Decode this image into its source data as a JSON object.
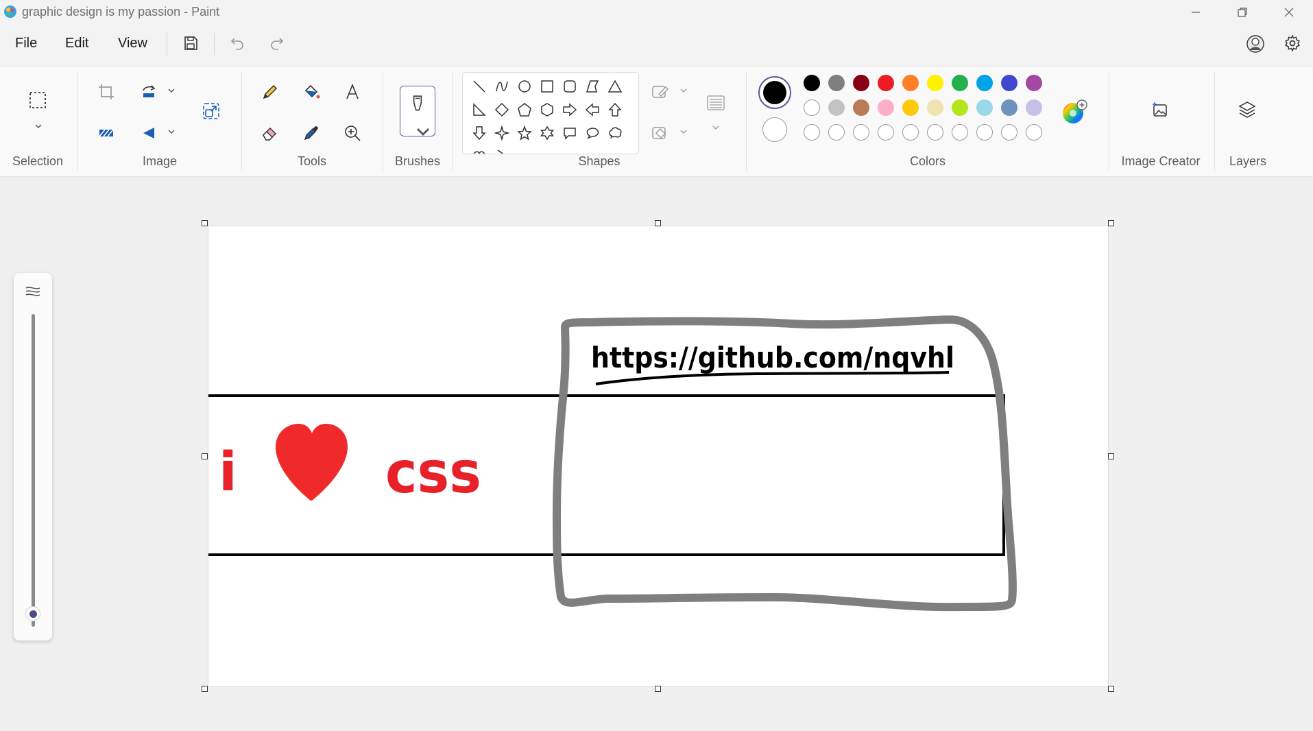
{
  "window": {
    "title": "graphic design is my passion - Paint"
  },
  "menu": {
    "file": "File",
    "edit": "Edit",
    "view": "View"
  },
  "ribbon": {
    "groups": {
      "selection": "Selection",
      "image": "Image",
      "tools": "Tools",
      "brushes": "Brushes",
      "shapes": "Shapes",
      "colors": "Colors",
      "image_creator": "Image Creator",
      "layers": "Layers"
    },
    "shape_icons": [
      "line-shape-icon",
      "curve-shape-icon",
      "oval-shape-icon",
      "rectangle-shape-icon",
      "rounded-rectangle-shape-icon",
      "polygon-shape-icon",
      "triangle-shape-icon",
      "right-triangle-shape-icon",
      "diamond-shape-icon",
      "pentagon-shape-icon",
      "hexagon-shape-icon",
      "right-arrow-shape-icon",
      "left-arrow-shape-icon",
      "up-arrow-shape-icon",
      "down-arrow-shape-icon",
      "four-point-star-shape-icon",
      "five-point-star-shape-icon",
      "six-point-star-shape-icon",
      "rect-callout-shape-icon",
      "oval-callout-shape-icon",
      "cloud-callout-shape-icon"
    ]
  },
  "colors": {
    "primary": "#000000",
    "secondary": "#ffffff",
    "row1": [
      "#000000",
      "#7f7f7f",
      "#880015",
      "#ed1c24",
      "#ff7f27",
      "#fff200",
      "#22b14c",
      "#00a2e8",
      "#3f48cc",
      "#a349a4"
    ],
    "row2": [
      "#ffffff",
      "#c3c3c3",
      "#b97a57",
      "#ffaec9",
      "#ffc90e",
      "#efe4b0",
      "#b5e61d",
      "#99d9ea",
      "#7092be",
      "#c8bfe7"
    ],
    "row3_empty_count": 10
  },
  "canvas": {
    "drawing_text_i": "i",
    "drawing_text_css": "css",
    "handwritten_url": "https://github.com/nqvhl",
    "heart_color": "#f02a2a",
    "gray_outline_color": "#7f7f7f"
  },
  "zoom": {
    "level_fraction": 0.08
  }
}
